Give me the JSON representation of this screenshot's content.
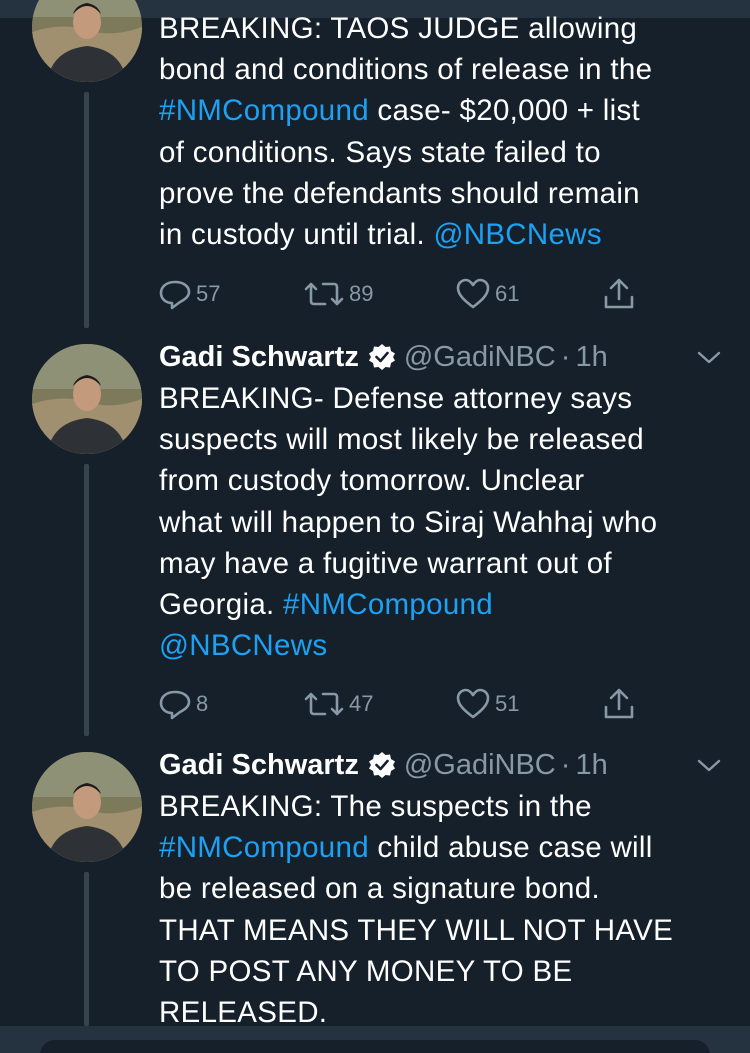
{
  "tweets": [
    {
      "name": "",
      "handle": "",
      "time": "",
      "lines": [
        [
          {
            "t": "BREAKING: TAOS JUDGE allowing",
            "link": false
          }
        ],
        [
          {
            "t": "bond and conditions of release in the",
            "link": false
          }
        ],
        [
          {
            "t": "#NMCompound",
            "link": true
          },
          {
            "t": " case- $20,000 + list",
            "link": false
          }
        ],
        [
          {
            "t": "of conditions.  Says state failed to",
            "link": false
          }
        ],
        [
          {
            "t": "prove the defendants should remain",
            "link": false
          }
        ],
        [
          {
            "t": "in custody until trial. ",
            "link": false
          },
          {
            "t": "@NBCNews",
            "link": true
          }
        ]
      ],
      "replies": "57",
      "retweets": "89",
      "likes": "61"
    },
    {
      "name": "Gadi Schwartz",
      "handle": "@GadiNBC",
      "time": "1h",
      "lines": [
        [
          {
            "t": "BREAKING- Defense attorney says",
            "link": false
          }
        ],
        [
          {
            "t": "suspects will most likely be released",
            "link": false
          }
        ],
        [
          {
            "t": "from custody tomorrow. Unclear",
            "link": false
          }
        ],
        [
          {
            "t": "what will happen to Siraj Wahhaj who",
            "link": false
          }
        ],
        [
          {
            "t": "may have a fugitive warrant out of",
            "link": false
          }
        ],
        [
          {
            "t": "Georgia. ",
            "link": false
          },
          {
            "t": "#NMCompound",
            "link": true
          }
        ],
        [
          {
            "t": "@NBCNews",
            "link": true
          }
        ]
      ],
      "replies": "8",
      "retweets": "47",
      "likes": "51"
    },
    {
      "name": "Gadi Schwartz",
      "handle": "@GadiNBC",
      "time": "1h",
      "lines": [
        [
          {
            "t": "BREAKING: The suspects in the",
            "link": false
          }
        ],
        [
          {
            "t": "#NMCompound",
            "link": true
          },
          {
            "t": " child abuse case will",
            "link": false
          }
        ],
        [
          {
            "t": "be released on a signature bond.",
            "link": false
          }
        ],
        [
          {
            "t": "THAT MEANS THEY WILL NOT HAVE",
            "link": false
          }
        ],
        [
          {
            "t": "TO POST ANY MONEY TO BE",
            "link": false
          }
        ],
        [
          {
            "t": "RELEASED.",
            "link": false
          }
        ]
      ]
    }
  ],
  "separator": "·",
  "colors": {
    "background": "#15202b",
    "text": "#ffffff",
    "muted": "#8899a6",
    "link": "#1da1f2",
    "thread_line": "#38444d"
  },
  "icons": [
    "reply-icon",
    "retweet-icon",
    "like-icon",
    "share-icon",
    "verified-badge-icon",
    "chevron-down-icon"
  ]
}
